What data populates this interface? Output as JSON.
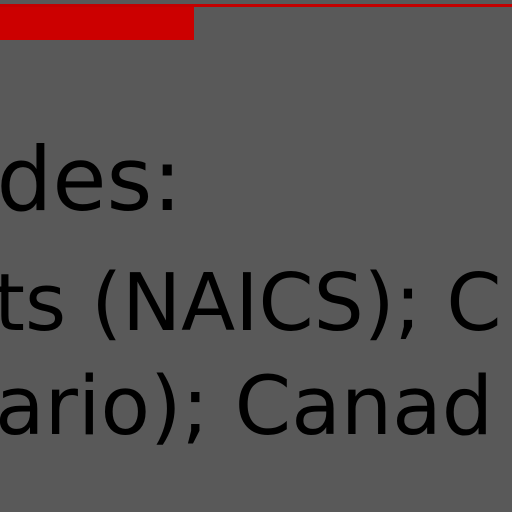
{
  "slide": {
    "heading": "des:",
    "line_one": "ts (NAICS); C",
    "line_two": "ario); Canad"
  },
  "colors": {
    "background": "#595959",
    "accent": "#cc0000",
    "text": "#000000"
  }
}
